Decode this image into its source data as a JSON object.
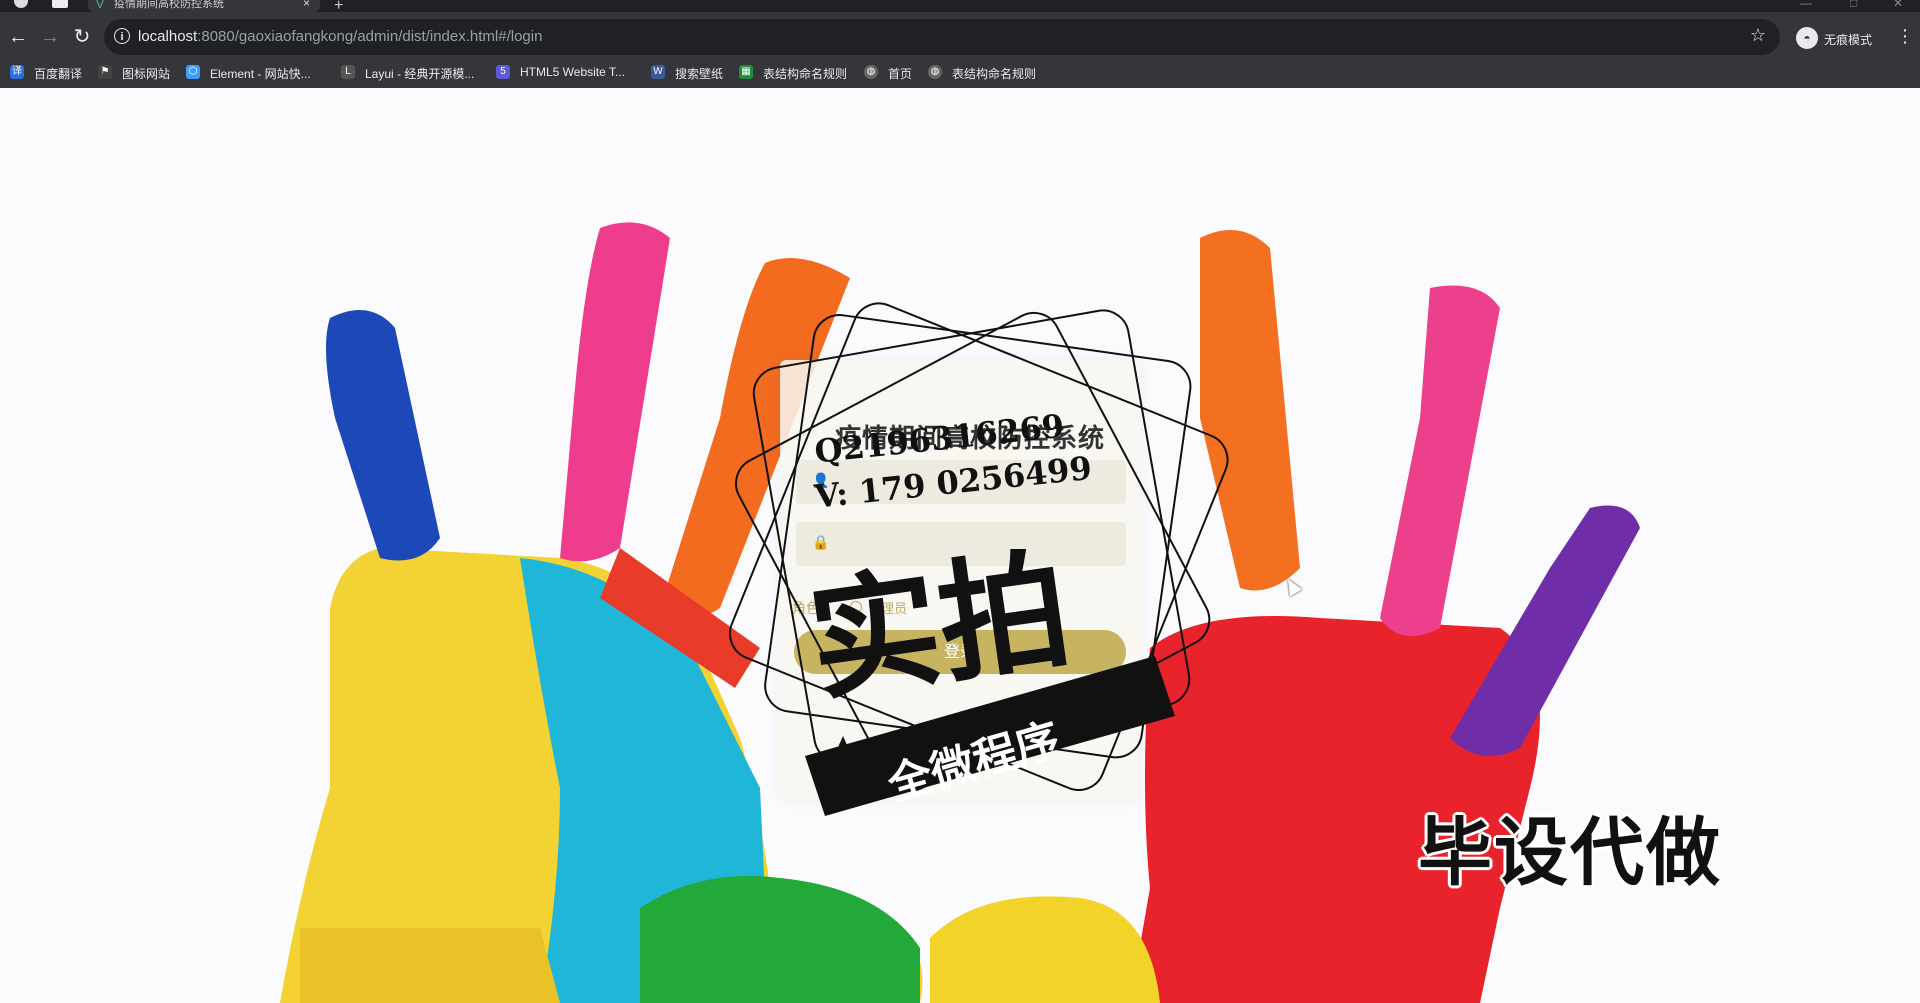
{
  "browser": {
    "tab_title": "疫情期间高校防控系统",
    "new_tab": "+",
    "close_tab": "×",
    "url_host": "localhost",
    "url_rest": ":8080/gaoxiaofangkong/admin/dist/index.html#/login",
    "incognito_label": "无痕模式",
    "bookmarks": [
      {
        "label": "百度翻译",
        "icon": "translate-icon",
        "color": "#2f6de1"
      },
      {
        "label": "图标网站",
        "icon": "flag-icon",
        "color": "#444"
      },
      {
        "label": "Element - 网站快...",
        "icon": "element-icon",
        "color": "#409eff"
      },
      {
        "label": "Layui - 经典开源模...",
        "icon": "layui-icon",
        "color": "#555"
      },
      {
        "label": "HTML5 Website T...",
        "icon": "html5-icon",
        "color": "#5b5bd6"
      },
      {
        "label": "搜索壁纸",
        "icon": "wallpaper-icon",
        "color": "#3b5998"
      },
      {
        "label": "表结构命名规则",
        "icon": "sheet-icon",
        "color": "#1e8e3e"
      },
      {
        "label": "首页",
        "icon": "globe-icon",
        "color": "#666"
      },
      {
        "label": "表结构命名规则",
        "icon": "globe-icon",
        "color": "#666"
      }
    ]
  },
  "login": {
    "title": "疫情期间高校防控系统",
    "username_placeholder": "",
    "password_placeholder": "",
    "role_label": "角色",
    "role_option": "管理员",
    "submit_label": "登录"
  },
  "watermark": {
    "qq_line1": "Q2196316269",
    "qq_line2": "V: 179 0256499",
    "big_text": "实拍",
    "banner_text": "全微程序",
    "corner_text": "毕设代做"
  },
  "colors": {
    "accent": "#c7b461",
    "chrome_dark": "#35363a"
  }
}
